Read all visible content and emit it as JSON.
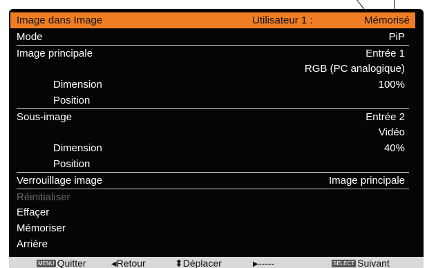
{
  "header": {
    "title": "Image dans Image",
    "user_label": "Utilisateur 1 :",
    "status": "Mémorisé"
  },
  "menu": {
    "mode": {
      "label": "Mode",
      "value": "PiP"
    },
    "main_image": {
      "label": "Image principale",
      "value": "Entrée 1",
      "value2": "RGB (PC analogique)"
    },
    "main_dimension": {
      "label": "Dimension",
      "value": "100%"
    },
    "main_position": {
      "label": "Position"
    },
    "sub_image": {
      "label": "Sous-image",
      "value": "Entrée 2",
      "value2": "Vidéo"
    },
    "sub_dimension": {
      "label": "Dimension",
      "value": "40%"
    },
    "sub_position": {
      "label": "Position"
    },
    "lock": {
      "label": "Verrouillage image",
      "value": "Image principale"
    },
    "reset": {
      "label": "Réinitialiser"
    },
    "clear": {
      "label": "Effaçer"
    },
    "save": {
      "label": "Mémoriser"
    },
    "back": {
      "label": "Arrière"
    }
  },
  "footer": {
    "quit": {
      "key": "MENU",
      "label": "Quitter"
    },
    "return": {
      "icon": "◀",
      "label": "Retour"
    },
    "move": {
      "icon": "⬍",
      "label": "Déplacer"
    },
    "next_arrow": {
      "icon": "▶",
      "label": "-----"
    },
    "next": {
      "key": "SELECT",
      "label": "Suivant"
    }
  },
  "colors": {
    "title_bar": "#f07d22",
    "background": "#050505",
    "footer": "#d9d9d9",
    "text": "#ffffff",
    "disabled": "#6a6a6a"
  }
}
